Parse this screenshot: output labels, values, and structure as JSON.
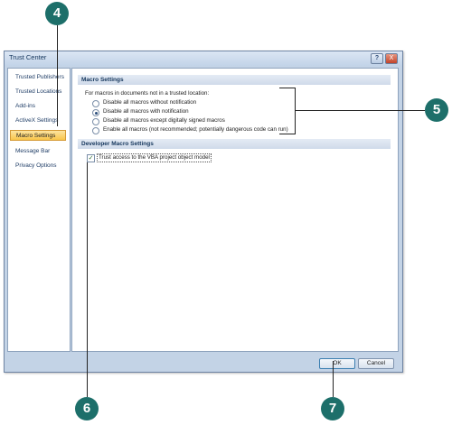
{
  "window": {
    "title": "Trust Center",
    "help_label": "?",
    "close_label": "X"
  },
  "sidebar": {
    "items": [
      {
        "label": "Trusted Publishers",
        "active": false
      },
      {
        "label": "Trusted Locations",
        "active": false
      },
      {
        "label": "Add-ins",
        "active": false
      },
      {
        "label": "ActiveX Settings",
        "active": false
      },
      {
        "label": "Macro Settings",
        "active": true
      },
      {
        "label": "Message Bar",
        "active": false
      },
      {
        "label": "Privacy Options",
        "active": false
      }
    ]
  },
  "macro_settings": {
    "header": "Macro Settings",
    "intro": "For macros in documents not in a trusted location:",
    "options": [
      {
        "label": "Disable all macros without notification",
        "selected": false
      },
      {
        "label": "Disable all macros with notification",
        "selected": true
      },
      {
        "label": "Disable all macros except digitally signed macros",
        "selected": false
      },
      {
        "label": "Enable all macros (not recommended; potentially dangerous code can run)",
        "selected": false
      }
    ]
  },
  "developer_settings": {
    "header": "Developer Macro Settings",
    "trust_vba_label": "Trust access to the VBA project object model",
    "trust_vba_checked": true,
    "check_glyph": "✓"
  },
  "buttons": {
    "ok": "OK",
    "cancel": "Cancel"
  },
  "callouts": {
    "four": "4",
    "five": "5",
    "six": "6",
    "seven": "7"
  }
}
